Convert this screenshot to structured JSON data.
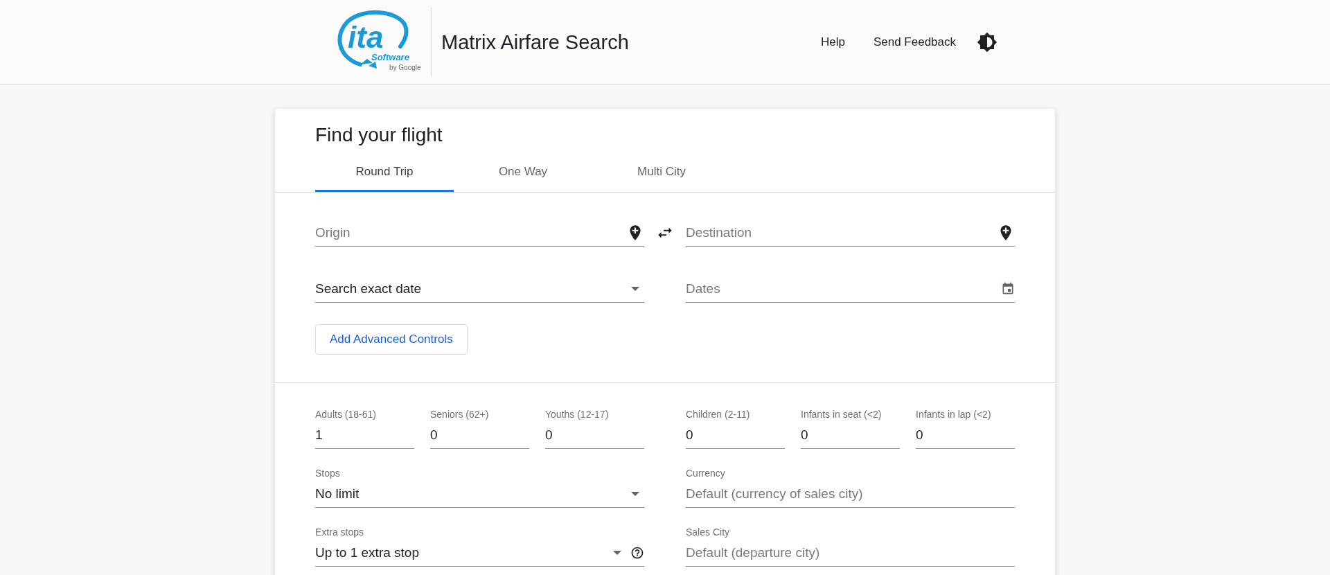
{
  "header": {
    "logo": {
      "main": "ita",
      "sub": "Software",
      "by": "by Google"
    },
    "title": "Matrix Airfare Search",
    "links": [
      "Help",
      "Send Feedback"
    ]
  },
  "card": {
    "title": "Find your flight",
    "tabs": [
      {
        "label": "Round Trip",
        "selected": true
      },
      {
        "label": "One Way",
        "selected": false
      },
      {
        "label": "Multi City",
        "selected": false
      }
    ],
    "route": {
      "origin": {
        "placeholder": "Origin"
      },
      "destination": {
        "placeholder": "Destination"
      },
      "date_mode": {
        "value": "Search exact date"
      },
      "dates": {
        "placeholder": "Dates"
      }
    },
    "advanced_button": "Add Advanced Controls",
    "passengers": {
      "left": [
        {
          "label": "Adults (18-61)",
          "value": "1"
        },
        {
          "label": "Seniors (62+)",
          "value": "0"
        },
        {
          "label": "Youths (12-17)",
          "value": "0"
        }
      ],
      "right": [
        {
          "label": "Children (2-11)",
          "value": "0"
        },
        {
          "label": "Infants in seat (<2)",
          "value": "0"
        },
        {
          "label": "Infants in lap (<2)",
          "value": "0"
        }
      ]
    },
    "options": [
      {
        "label": "Stops",
        "value": "No limit",
        "kind": "select"
      },
      {
        "label": "Currency",
        "placeholder": "Default (currency of sales city)",
        "kind": "text"
      },
      {
        "label": "Extra stops",
        "value": "Up to 1 extra stop",
        "kind": "select-help"
      },
      {
        "label": "Sales City",
        "placeholder": "Default (departure city)",
        "kind": "text"
      }
    ]
  }
}
